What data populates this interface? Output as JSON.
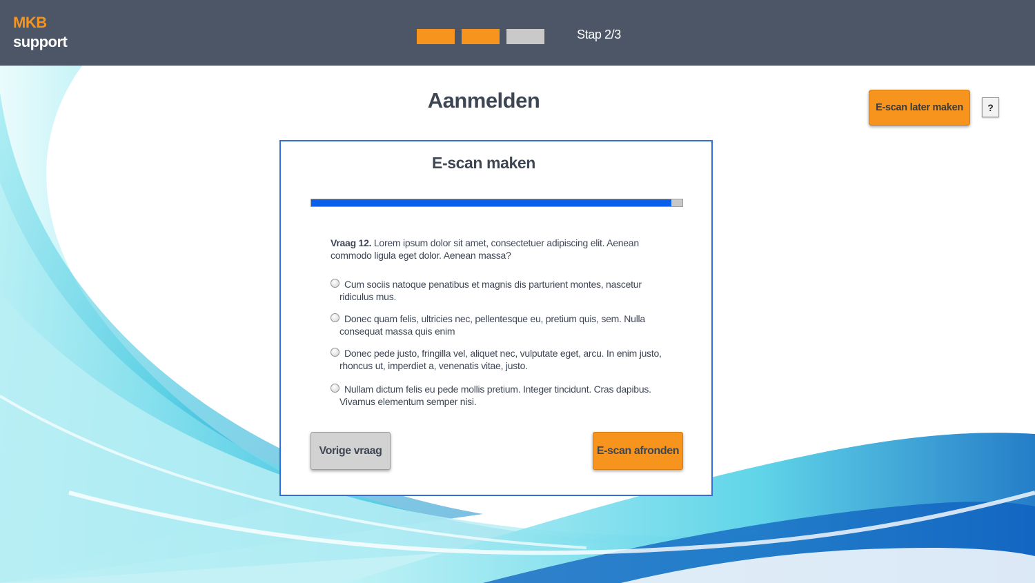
{
  "header": {
    "logo_line1": "MKB",
    "logo_line2": "support",
    "steps": [
      {
        "state": "done"
      },
      {
        "state": "done"
      },
      {
        "state": "todo"
      }
    ],
    "step_label": "Stap 2/3"
  },
  "page": {
    "title": "Aanmelden",
    "later_button": "E-scan later maken",
    "help_button": "?"
  },
  "card": {
    "title": "E-scan maken",
    "progress_fraction": 0.97,
    "question_number": "Vraag 12.",
    "question_text": " Lorem ipsum dolor sit amet, consectetuer adipiscing elit. Aenean commodo ligula eget dolor. Aenean massa?",
    "options": [
      "Cum sociis natoque penatibus et magnis dis parturient montes, nascetur ridiculus mus.",
      "Donec quam felis, ultricies nec, pellentesque eu, pretium quis, sem. Nulla consequat massa quis enim",
      "Donec pede justo, fringilla vel, aliquet nec, vulputate eget, arcu. In enim justo, rhoncus ut, imperdiet a, venenatis vitae, justo.",
      "Nullam dictum felis eu pede mollis pretium. Integer tincidunt. Cras dapibus. Vivamus elementum semper nisi."
    ],
    "prev_button": "Vorige vraag",
    "finish_button": "E-scan afronden"
  },
  "colors": {
    "header_bg": "#4c5667",
    "accent_orange": "#f7941d",
    "progress_blue": "#0a5fea",
    "card_border": "#2f6fd6",
    "text_dark": "#3e4654"
  }
}
